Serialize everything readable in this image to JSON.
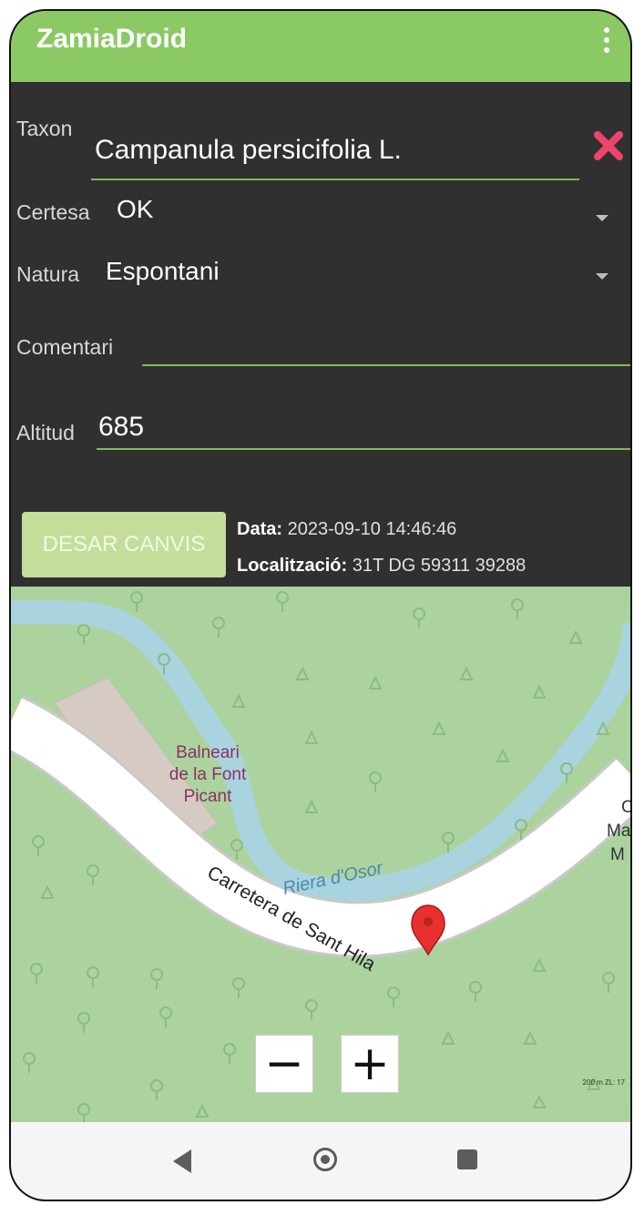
{
  "app": {
    "title": "ZamiaDroid"
  },
  "form": {
    "taxon": {
      "label": "Taxon",
      "value": "Campanula persicifolia L."
    },
    "certesa": {
      "label": "Certesa",
      "value": "OK"
    },
    "natura": {
      "label": "Natura",
      "value": "Espontani"
    },
    "comentari": {
      "label": "Comentari",
      "value": ""
    },
    "altitud": {
      "label": "Altitud",
      "value": "685"
    },
    "save_label": "DESAR CANVIS",
    "data_label": "Data:",
    "data_value": "2023-09-10 14:46:46",
    "loc_label": "Localització:",
    "loc_value": "31T DG 59311 39288"
  },
  "map": {
    "place_line1": "Balneari",
    "place_line2": "de la Font",
    "place_line3": "Picant",
    "river": "Riera d'Osor",
    "road": "Carretera de Sant Hila",
    "edge1": "C",
    "edge2": "Ma",
    "edge3": "M",
    "zoom_out": "−",
    "zoom_in": "+",
    "scale_text": "200 m ZL: 17"
  },
  "colors": {
    "appbar": "#8bc964",
    "accent": "#7cbd5a",
    "delete": "#f0436b",
    "map_bg": "#acd39e",
    "river": "#a9d3df",
    "road": "#ffffff"
  }
}
